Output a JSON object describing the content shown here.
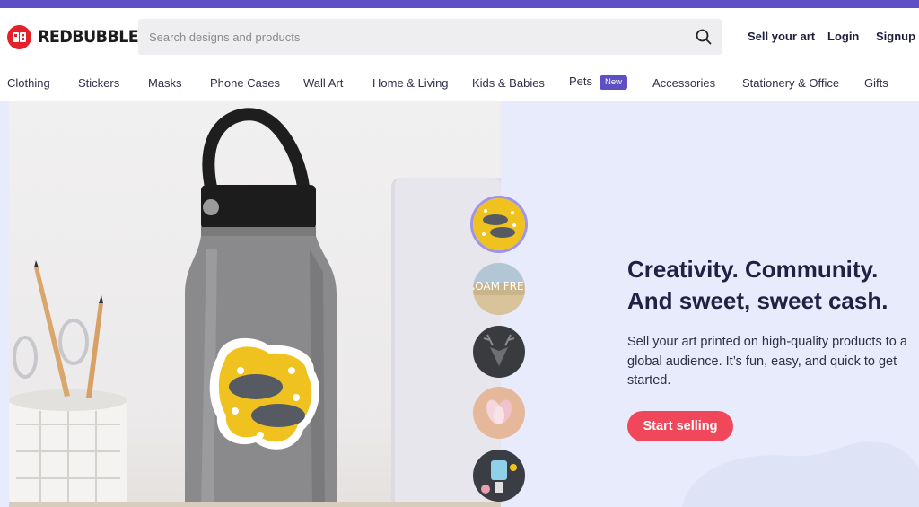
{
  "brand": {
    "name": "REDBUBBLE",
    "accent": "#5e4fc4",
    "logo_red": "#e4202a"
  },
  "search": {
    "placeholder": "Search designs and products",
    "value": ""
  },
  "header_links": {
    "sell": "Sell your art",
    "login": "Login",
    "signup": "Signup"
  },
  "nav": {
    "items": [
      {
        "label": "Clothing"
      },
      {
        "label": "Stickers"
      },
      {
        "label": "Masks"
      },
      {
        "label": "Phone Cases"
      },
      {
        "label": "Wall Art"
      },
      {
        "label": "Home & Living"
      },
      {
        "label": "Kids & Babies"
      },
      {
        "label": "Pets",
        "badge": "New"
      },
      {
        "label": "Accessories"
      },
      {
        "label": "Stationery & Office"
      },
      {
        "label": "Gifts"
      }
    ]
  },
  "hero": {
    "title_line1": "Creativity. Community.",
    "title_line2": "And sweet, sweet cash.",
    "text": "Sell your art printed on high-quality products to a global audience. It’s fun, easy, and quick to get started.",
    "cta": "Start selling",
    "cta_color": "#f0475b",
    "thumbnails": [
      {
        "icon": "badger-sticker-thumbnail",
        "selected": true
      },
      {
        "icon": "roam-free-thumbnail",
        "text": "ROAM FREE",
        "selected": false
      },
      {
        "icon": "deer-head-thumbnail",
        "selected": false
      },
      {
        "icon": "magnolia-flower-thumbnail",
        "selected": false
      },
      {
        "icon": "robot-collage-thumbnail",
        "selected": false
      }
    ]
  }
}
